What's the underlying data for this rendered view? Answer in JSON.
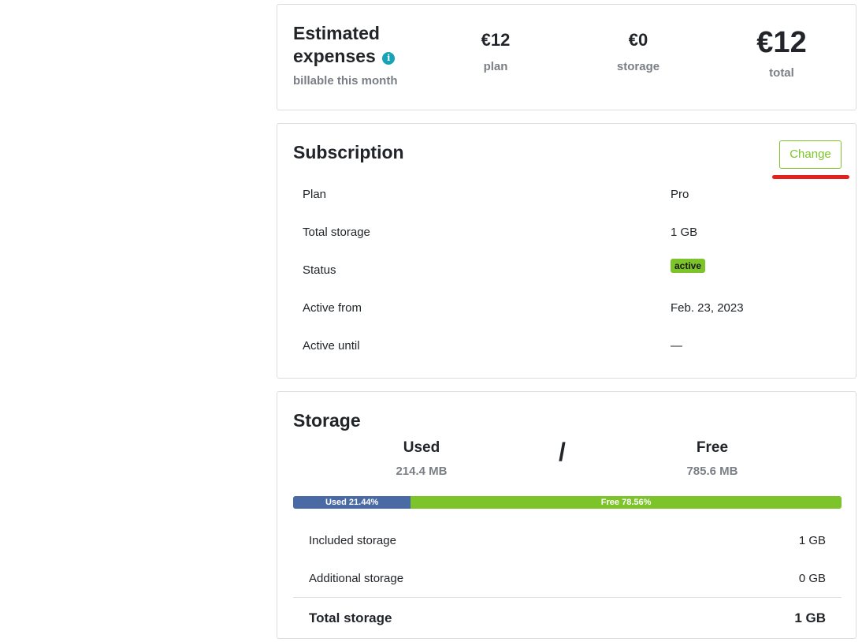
{
  "expenses": {
    "title": "Estimated expenses",
    "subtitle": "billable this month",
    "info_icon": "i",
    "plan_amount": "€12",
    "plan_label": "plan",
    "storage_amount": "€0",
    "storage_label": "storage",
    "total_amount": "€12",
    "total_label": "total"
  },
  "subscription": {
    "title": "Subscription",
    "change_label": "Change",
    "rows": [
      {
        "key": "Plan",
        "value": "Pro"
      },
      {
        "key": "Total storage",
        "value": "1 GB"
      },
      {
        "key": "Status",
        "value": "active"
      },
      {
        "key": "Active from",
        "value": "Feb. 23, 2023"
      },
      {
        "key": "Active until",
        "value": "—"
      }
    ]
  },
  "storage": {
    "title": "Storage",
    "used_heading": "Used",
    "used_value": "214.4 MB",
    "separator": "/",
    "free_heading": "Free",
    "free_value": "785.6 MB",
    "used_percent": 21.44,
    "free_percent": 78.56,
    "used_bar_label": "Used 21.44%",
    "free_bar_label": "Free 78.56%",
    "rows": [
      {
        "key": "Included storage",
        "value": "1 GB"
      },
      {
        "key": "Additional storage",
        "value": "0 GB"
      }
    ],
    "total": {
      "key": "Total storage",
      "value": "1 GB"
    }
  },
  "colors": {
    "accent_green": "#7dc42a",
    "used_blue": "#4a6aa5",
    "info_teal": "#17a2b8",
    "annotation_red": "#e3211f"
  }
}
